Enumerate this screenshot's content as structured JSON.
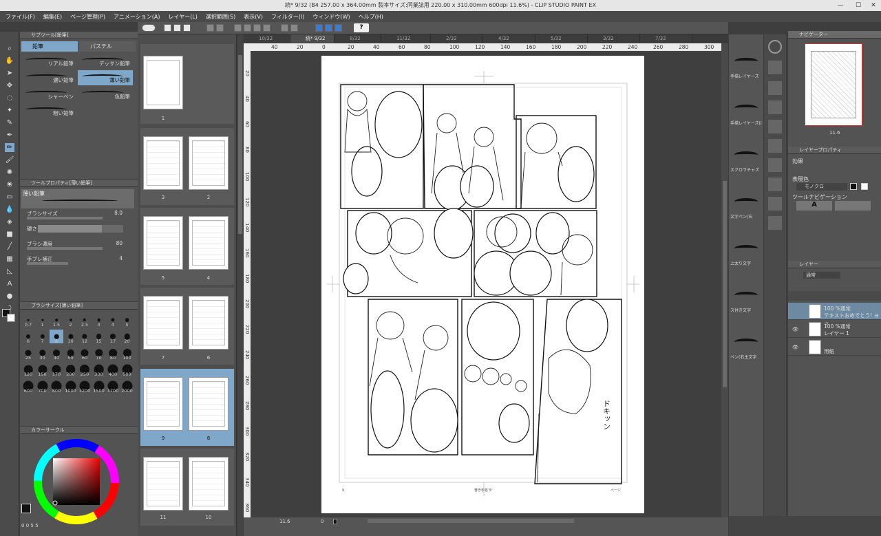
{
  "window": {
    "title": "続* 9/32 (B4 257.00 x 364.00mm 製本サイズ:同業誌用 220.00 x 310.00mm 600dpi 11.6%) - CLIP STUDIO PAINT EX",
    "minimize": "—",
    "maximize": "☐",
    "close": "✕"
  },
  "menu": [
    "ファイル(F)",
    "編集(E)",
    "ページ管理(P)",
    "アニメーション(A)",
    "レイヤー(L)",
    "選択範囲(S)",
    "表示(V)",
    "フィルター(I)",
    "ウィンドウ(W)",
    "ヘルプ(H)"
  ],
  "command_bar": {
    "help_label": "?"
  },
  "subtool": {
    "header": "サブツール[鉛筆]",
    "tabs": [
      "鉛筆",
      "パステル"
    ],
    "brushes": [
      "リアル鉛筆",
      "デッサン鉛筆",
      "濃い鉛筆",
      "薄い鉛筆",
      "シャーペン",
      "色鉛筆",
      "粗い鉛筆"
    ]
  },
  "tool_property": {
    "header": "ツールプロパティ[薄い鉛筆]",
    "brush_name": "薄い鉛筆",
    "brush_size_label": "ブラシサイズ",
    "brush_size_value": "8.0",
    "hardness_label": "硬さ",
    "density_label": "ブラシ濃度",
    "density_value": "80",
    "stabilization_label": "手ブレ補正",
    "stabilization_value": "4"
  },
  "brush_size": {
    "header": "ブラシサイズ[薄い鉛筆]",
    "sizes": [
      "0.7",
      "1",
      "1.5",
      "2",
      "2.5",
      "3",
      "4",
      "5",
      "6",
      "7",
      "8",
      "10",
      "12",
      "15",
      "17",
      "20",
      "25",
      "30",
      "40",
      "50",
      "60",
      "70",
      "80",
      "100",
      "120",
      "150",
      "170",
      "200",
      "250",
      "300",
      "400",
      "500",
      "600",
      "700",
      "800",
      "1000",
      "1200",
      "1500",
      "1700",
      "2000"
    ]
  },
  "color_panel": {
    "header": "カラーサークル",
    "values": [
      "0",
      "0",
      "5",
      "5"
    ]
  },
  "page_manager": {
    "labels": [
      "1",
      "3",
      "2",
      "5",
      "4",
      "7",
      "6",
      "9",
      "8",
      "11",
      "10"
    ]
  },
  "tabs": [
    "10/32",
    "続* 9/32",
    "8/32",
    "11/32",
    "2/32",
    "4/32",
    "5/32",
    "3/32",
    "7/32"
  ],
  "ruler_h": [
    "40",
    "20",
    "0",
    "20",
    "40",
    "60",
    "80",
    "100",
    "120",
    "140",
    "160",
    "180",
    "200",
    "220",
    "240",
    "260",
    "280",
    "300"
  ],
  "ruler_v": [
    "20",
    "40",
    "60",
    "80",
    "100",
    "120",
    "140",
    "160",
    "180",
    "200",
    "220",
    "240",
    "260",
    "280",
    "300",
    "320",
    "340",
    "360"
  ],
  "status": {
    "zoom": "11.6",
    "angle": "0"
  },
  "material_panel": {
    "items": [
      "手描レイヤーズ",
      "手描レイヤーズ(ぼ",
      "スクロラチャズ",
      "文字ペン(右",
      "上太り文字",
      "ス付き文字",
      "ペン(右主文字"
    ]
  },
  "navigator": {
    "header": "ナビゲーター",
    "zoom": "11.6"
  },
  "layer_property": {
    "header": "レイヤープロパティ",
    "effect_label": "効果",
    "express_color_label": "表現色",
    "express_color_value": "モノクロ",
    "tool_nav_label": "ツールナビゲーション"
  },
  "layers": {
    "header": "レイヤー",
    "blend_mode": "通常",
    "rows": [
      {
        "line1": "100 %通常",
        "line2": "テキストおめでとう! ヨッ",
        "selected": true
      },
      {
        "line1": "100 %通常",
        "line2": "レイヤー 1",
        "selected": false
      },
      {
        "line1": "",
        "line2": "用紙",
        "selected": false
      }
    ]
  },
  "page_footer": {
    "left": "9",
    "center": "書き手名 9",
    "right": "ページ"
  },
  "sound_effect": "ドキッン"
}
